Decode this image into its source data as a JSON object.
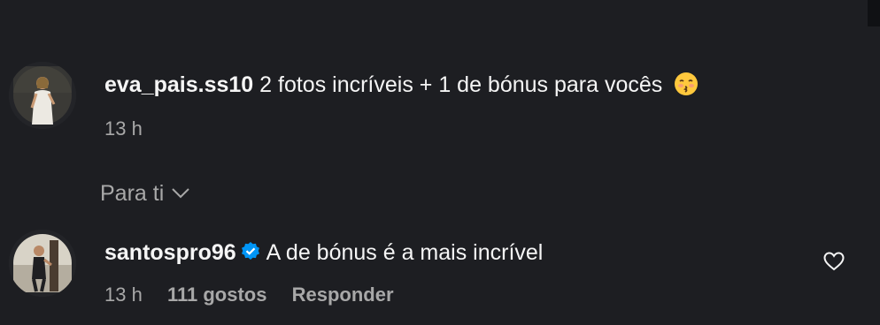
{
  "caption": {
    "username": "eva_pais.ss10",
    "text": "2 fotos incríveis + 1 de bónus para vocês",
    "emoji": "kissing-face-emoji",
    "time": "13 h"
  },
  "filter": {
    "label": "Para ti",
    "icon": "chevron-down-icon"
  },
  "reply": {
    "username": "santospro96",
    "verified_icon": "verified-badge-icon",
    "text": "A de bónus é a mais incrível",
    "time": "13 h",
    "likes": "111 gostos",
    "reply_label": "Responder",
    "like_icon": "heart-outline-icon"
  },
  "colors": {
    "background": "#1d1e22",
    "text": "#f5f5f5",
    "muted": "#a8a8a8",
    "verified": "#0095f6"
  }
}
